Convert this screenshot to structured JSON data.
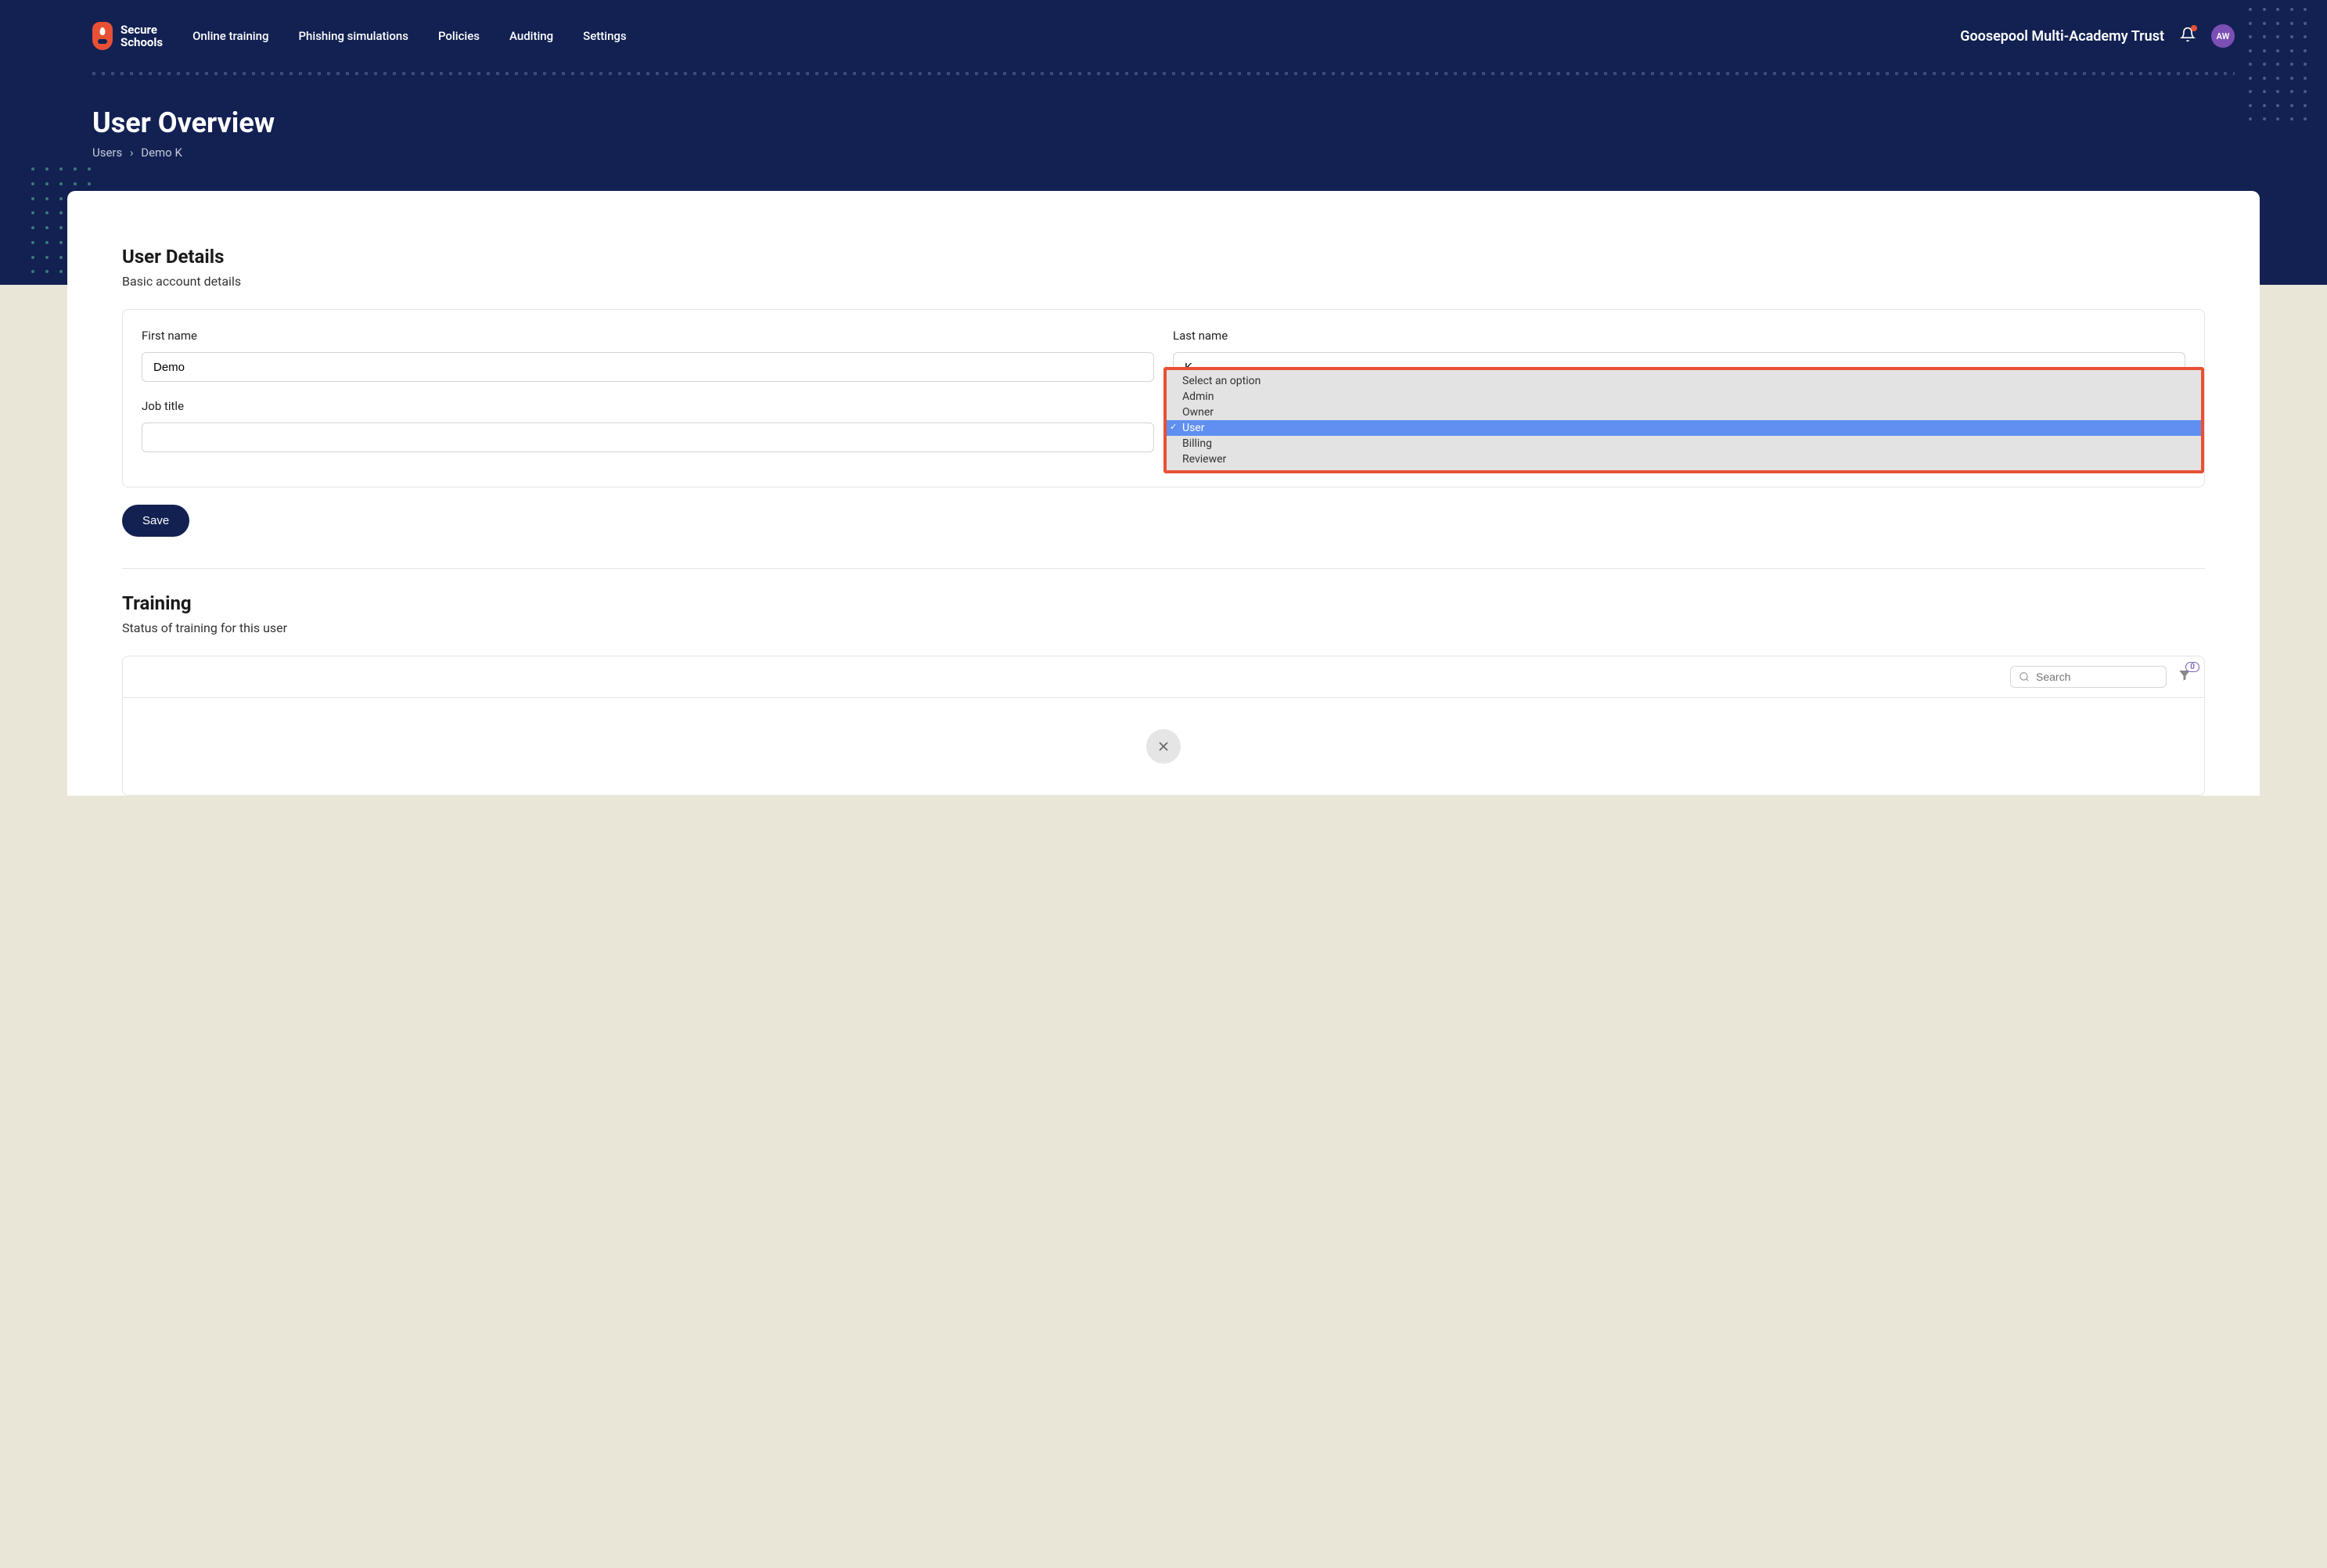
{
  "brand": {
    "line1": "Secure",
    "line2": "Schools"
  },
  "nav": {
    "items": [
      "Online training",
      "Phishing simulations",
      "Policies",
      "Auditing",
      "Settings"
    ],
    "org_name": "Goosepool Multi-Academy Trust",
    "avatar_initials": "AW"
  },
  "page": {
    "title": "User Overview",
    "breadcrumb_root": "Users",
    "breadcrumb_current": "Demo K"
  },
  "details": {
    "title": "User Details",
    "subtitle": "Basic account details",
    "first_name_label": "First name",
    "first_name_value": "Demo",
    "last_name_label": "Last name",
    "last_name_value": "K",
    "job_title_label": "Job title",
    "job_title_value": "",
    "save_label": "Save"
  },
  "dropdown": {
    "options": [
      {
        "label": "Select an option",
        "selected": false
      },
      {
        "label": "Admin",
        "selected": false
      },
      {
        "label": "Owner",
        "selected": false
      },
      {
        "label": "User",
        "selected": true
      },
      {
        "label": "Billing",
        "selected": false
      },
      {
        "label": "Reviewer",
        "selected": false
      }
    ]
  },
  "training": {
    "title": "Training",
    "subtitle": "Status of training for this user",
    "search_placeholder": "Search",
    "filter_count": "0"
  }
}
